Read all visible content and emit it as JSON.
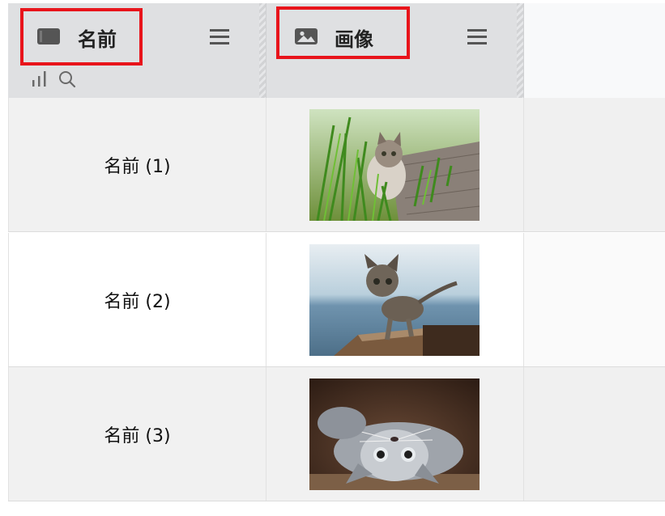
{
  "columns": [
    {
      "title": "名前",
      "type_icon": "text-field-icon"
    },
    {
      "title": "画像",
      "type_icon": "image-field-icon"
    }
  ],
  "rows": [
    {
      "name": "名前 (1)",
      "image": "kitten in green grass on wooden deck"
    },
    {
      "name": "名前 (2)",
      "image": "tabby kitten walking on wooden ledge by the sea"
    },
    {
      "name": "名前 (3)",
      "image": "fluffy grey cat lying upside down"
    }
  ],
  "icons": {
    "menu": "hamburger-menu-icon",
    "stats": "bar-chart-icon",
    "search": "search-icon"
  },
  "colors": {
    "highlight": "#e8141b",
    "header_bg": "#dfe0e2"
  }
}
